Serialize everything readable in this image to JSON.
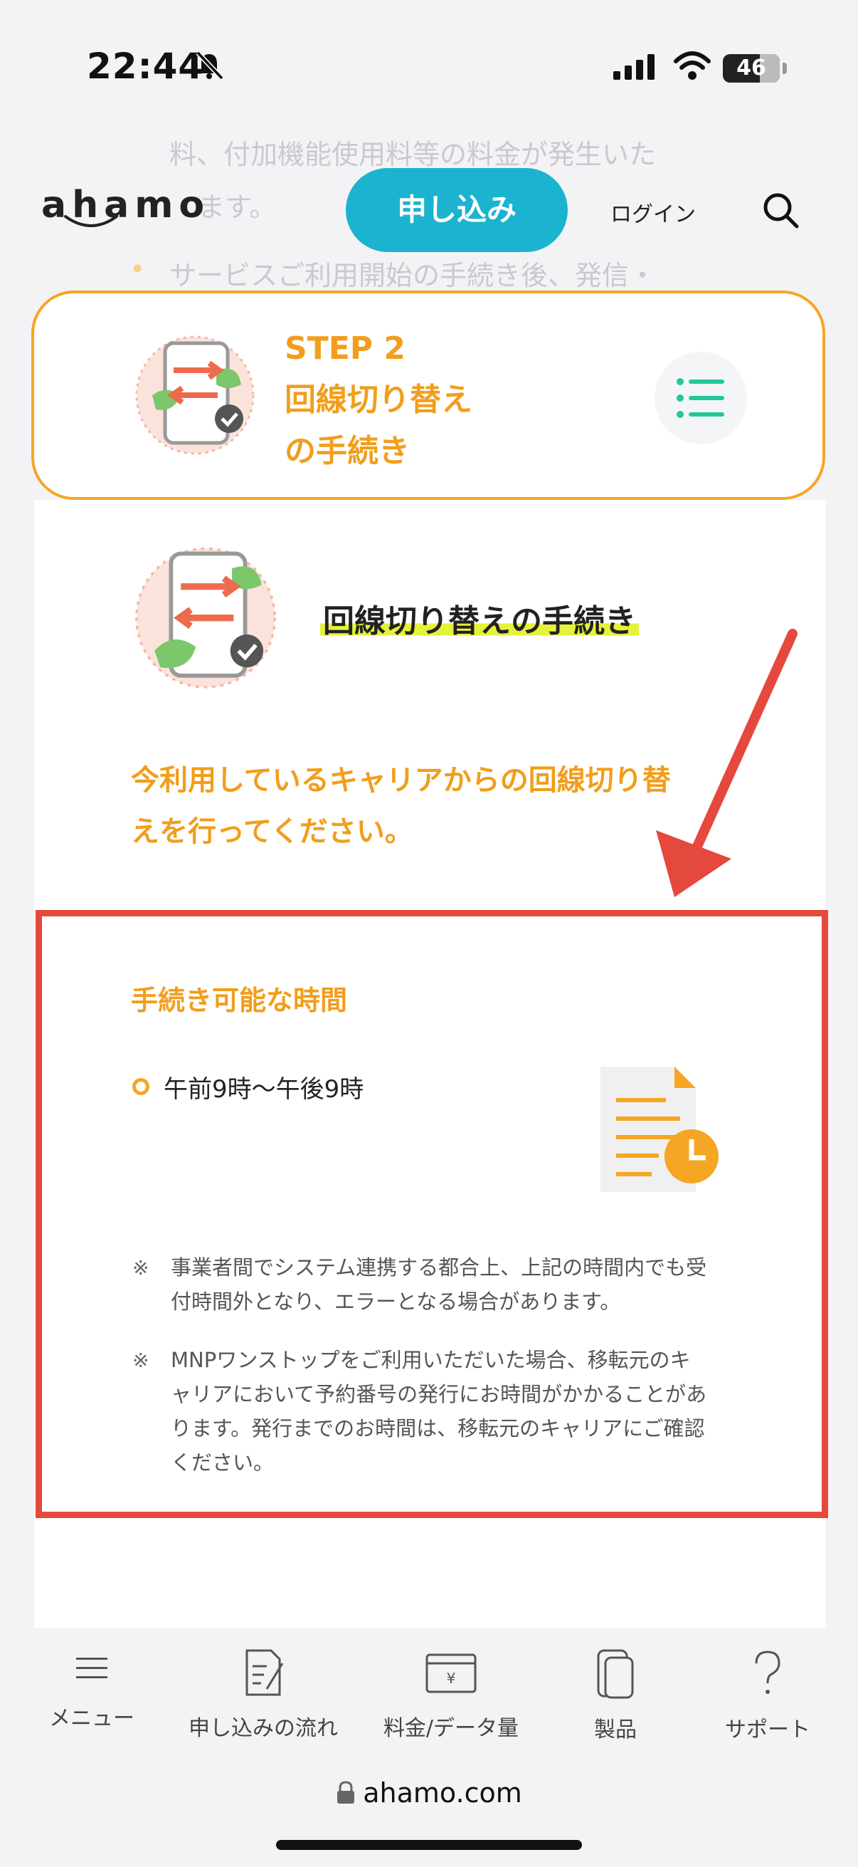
{
  "status_bar": {
    "time": "22:44",
    "battery": "46"
  },
  "background_text": {
    "line1": "料、付加機能使用料等の料金が発生いた",
    "line2": "ます。",
    "line3": "サービスご利用開始の手続き後、発信・"
  },
  "header": {
    "logo": "ahamo",
    "apply_label": "申し込み",
    "login_label": "ログイン"
  },
  "step_card": {
    "step": "STEP 2",
    "title_line1": "回線切り替え",
    "title_line2": "の手続き"
  },
  "section": {
    "heading": "回線切り替えの手続き",
    "lead_line1": "今利用しているキャリアからの回線切り替",
    "lead_line2": "えを行ってください。"
  },
  "hours_box": {
    "title": "手続き可能な時間",
    "hours": "午前9時〜午後9時",
    "note_mark": "※",
    "note1_line1": "事業者間でシステム連携する都合上、上記の時間内でも受",
    "note1_line2": "付時間外となり、エラーとなる場合があります。",
    "note2_line1": "MNPワンストップをご利用いただいた場合、移転元のキ",
    "note2_line2": "ャリアにおいて予約番号の発行にお時間がかかることがあ",
    "note2_line3": "ります。発行までのお時間は、移転元のキャリアにご確認",
    "note2_line4": "ください。"
  },
  "bottom_nav": {
    "items": [
      {
        "label": "メニュー",
        "icon": "hamburger-icon"
      },
      {
        "label": "申し込みの流れ",
        "icon": "document-edit-icon"
      },
      {
        "label": "料金/データ量",
        "icon": "wallet-yen-icon"
      },
      {
        "label": "製品",
        "icon": "smartphone-icon"
      },
      {
        "label": "サポート",
        "icon": "question-icon"
      }
    ]
  },
  "browser": {
    "url": "ahamo.com"
  },
  "colors": {
    "accent": "#1bb3cf",
    "orange": "#f19e1c",
    "highlight": "#e4f23a",
    "annotation_red": "#e5483c"
  }
}
